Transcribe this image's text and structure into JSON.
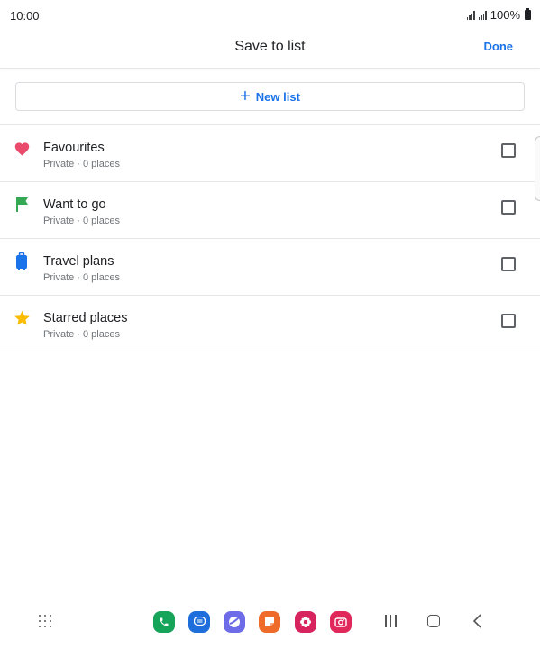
{
  "status_bar": {
    "time": "10:00",
    "battery_text": "100%"
  },
  "header": {
    "title": "Save to list",
    "done_label": "Done"
  },
  "new_list": {
    "label": "New list",
    "icon": "plus-icon"
  },
  "lists": [
    {
      "title": "Favourites",
      "subtitle": "Private · 0 places",
      "icon": "heart-icon",
      "color": "#ea4b6c",
      "checked": false
    },
    {
      "title": "Want to go",
      "subtitle": "Private · 0 places",
      "icon": "flag-icon",
      "color": "#34a853",
      "checked": false
    },
    {
      "title": "Travel plans",
      "subtitle": "Private · 0 places",
      "icon": "suitcase-icon",
      "color": "#1a73e8",
      "checked": false
    },
    {
      "title": "Starred places",
      "subtitle": "Private · 0 places",
      "icon": "star-icon",
      "color": "#fbbc04",
      "checked": false
    }
  ],
  "dock": [
    {
      "name": "phone-app-icon",
      "color": "#16a45a"
    },
    {
      "name": "messages-app-icon",
      "color": "#1e6fdc"
    },
    {
      "name": "internet-app-icon",
      "color": "#6d6be8"
    },
    {
      "name": "notes-app-icon",
      "color": "#ef6b2a"
    },
    {
      "name": "gallery-app-icon",
      "color": "#d8245e"
    },
    {
      "name": "camera-app-icon",
      "color": "#e0285a"
    }
  ],
  "colors": {
    "accent": "#1a73e8"
  }
}
